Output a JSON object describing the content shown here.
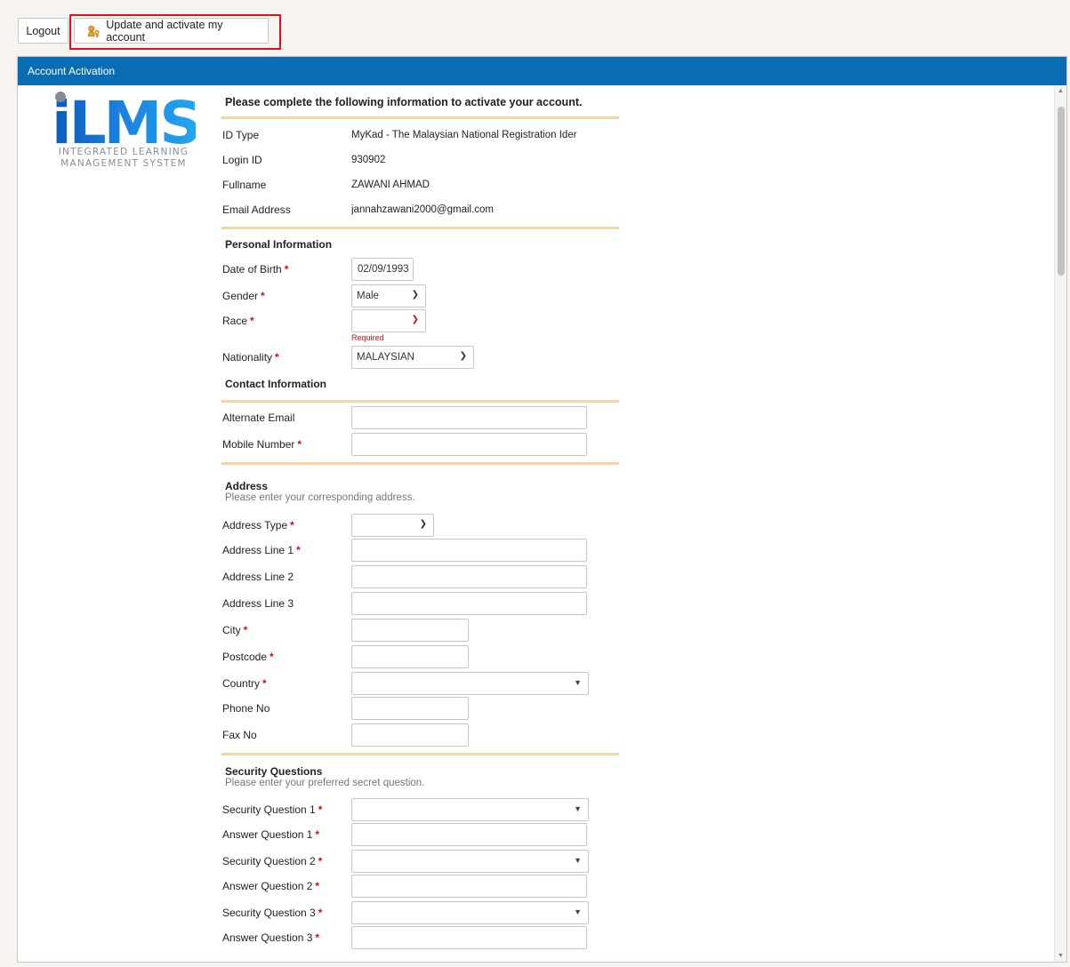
{
  "toolbar": {
    "logout_label": "Logout",
    "update_label": "Update and activate my account",
    "update_icon": "key-user-icon"
  },
  "panel": {
    "title": "Account Activation"
  },
  "logo": {
    "mark": "iLMS",
    "line1": "INTEGRATED LEARNING",
    "line2": "MANAGEMENT SYSTEM"
  },
  "form": {
    "intro": "Please complete the following information to activate your account.",
    "id_type": {
      "label": "ID Type",
      "value": "MyKad - The Malaysian National Registration Ider"
    },
    "login_id": {
      "label": "Login ID",
      "value": "930902"
    },
    "fullname": {
      "label": "Fullname",
      "value": "ZAWANI AHMAD"
    },
    "email": {
      "label": "Email Address",
      "value": "jannahzawani2000@gmail.com"
    },
    "personal": {
      "title": "Personal Information",
      "dob": {
        "label": "Date of Birth",
        "value": "02/09/1993"
      },
      "gender": {
        "label": "Gender",
        "value": "Male"
      },
      "race": {
        "label": "Race",
        "value": "",
        "error": "Required"
      },
      "nationality": {
        "label": "Nationality",
        "value": "MALAYSIAN"
      }
    },
    "contact": {
      "title": "Contact Information",
      "alt_email": {
        "label": "Alternate Email",
        "value": ""
      },
      "mobile": {
        "label": "Mobile Number",
        "value": ""
      }
    },
    "address": {
      "title": "Address",
      "subtitle": "Please enter your corresponding address.",
      "type": {
        "label": "Address Type",
        "value": ""
      },
      "line1": {
        "label": "Address Line 1",
        "value": ""
      },
      "line2": {
        "label": "Address Line 2",
        "value": ""
      },
      "line3": {
        "label": "Address Line 3",
        "value": ""
      },
      "city": {
        "label": "City",
        "value": ""
      },
      "postcode": {
        "label": "Postcode",
        "value": ""
      },
      "country": {
        "label": "Country",
        "value": ""
      },
      "phone": {
        "label": "Phone No",
        "value": ""
      },
      "fax": {
        "label": "Fax No",
        "value": ""
      }
    },
    "security": {
      "title": "Security Questions",
      "subtitle": "Please enter your preferred secret question.",
      "q1": {
        "label": "Security Question 1",
        "value": ""
      },
      "a1": {
        "label": "Answer Question 1",
        "value": ""
      },
      "q2": {
        "label": "Security Question 2",
        "value": ""
      },
      "a2": {
        "label": "Answer Question 2",
        "value": ""
      },
      "q3": {
        "label": "Security Question 3",
        "value": ""
      },
      "a3": {
        "label": "Answer Question 3",
        "value": ""
      }
    },
    "required_marker": "*"
  },
  "colors": {
    "header": "#0a6db3",
    "divider": "#f6d4a0",
    "required": "#d01010",
    "highlight": "#e0101c"
  }
}
